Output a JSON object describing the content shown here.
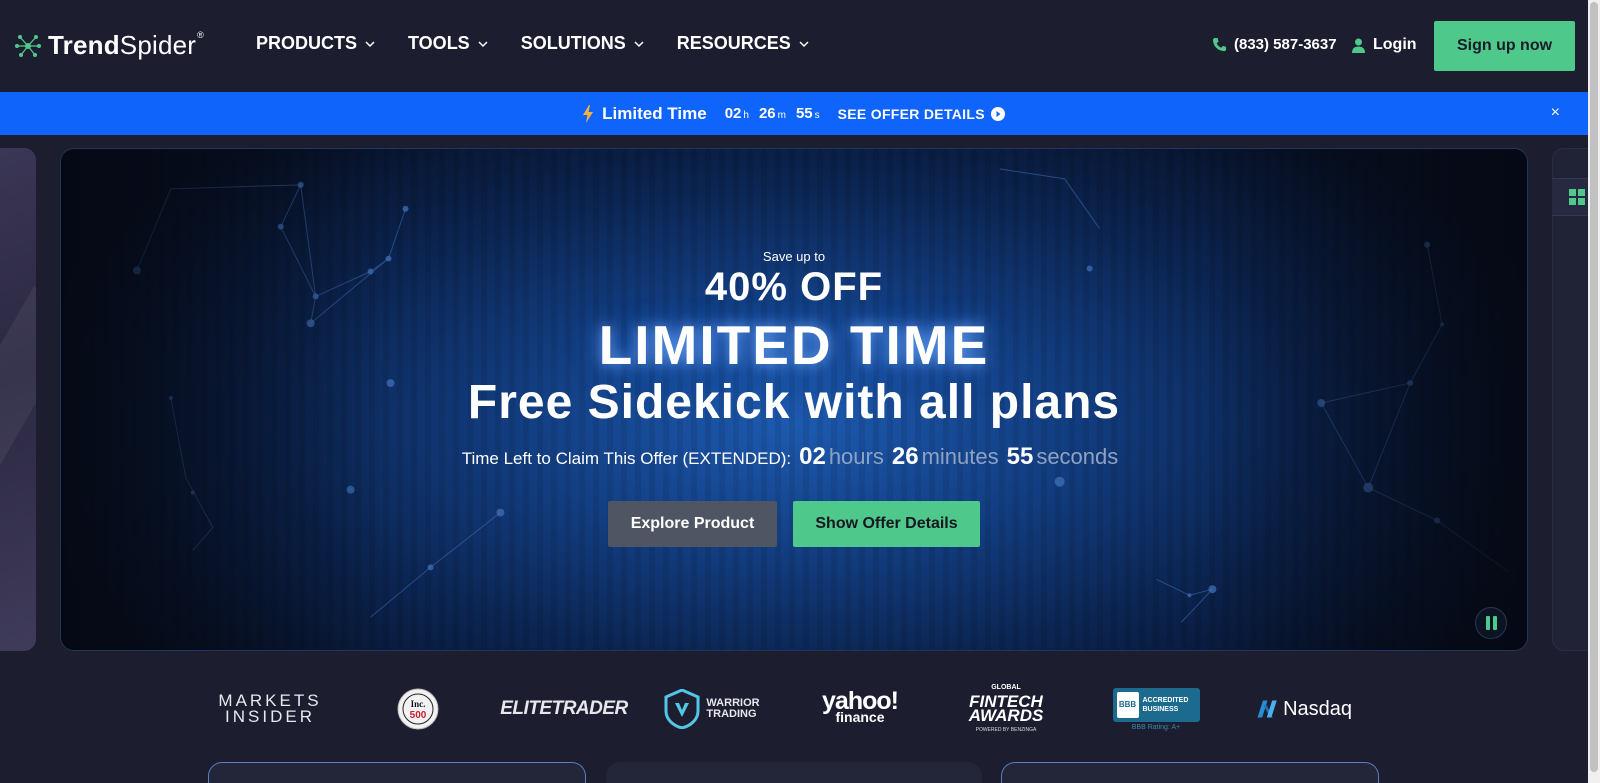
{
  "header": {
    "brand_bold": "Trend",
    "brand_thin": "Spider",
    "brand_reg": "®",
    "nav": [
      "PRODUCTS",
      "TOOLS",
      "SOLUTIONS",
      "RESOURCES"
    ],
    "phone": "(833) 587-3637",
    "login": "Login",
    "signup": "Sign up now"
  },
  "promo": {
    "label": "Limited Time",
    "hours": "02",
    "hours_unit": "h",
    "minutes": "26",
    "minutes_unit": "m",
    "seconds": "55",
    "seconds_unit": "s",
    "offer_link": "SEE OFFER DETAILS",
    "close": "×"
  },
  "hero": {
    "save_upto": "Save up to",
    "percent_off": "40% OFF",
    "headline": "LIMITED TIME",
    "subheadline": "Free Sidekick with all plans",
    "timer_label": "Time Left to Claim This Offer (EXTENDED):",
    "hours": "02",
    "hours_unit": "hours",
    "minutes": "26",
    "minutes_unit": "minutes",
    "seconds": "55",
    "seconds_unit": "seconds",
    "btn_explore": "Explore Product",
    "btn_offer": "Show Offer Details"
  },
  "logos": {
    "markets_insider_1": "MARKETS",
    "markets_insider_2": "INSIDER",
    "inc": "Inc. 500",
    "elite_trader": "ELITETRADER",
    "warrior_1": "WARRIOR",
    "warrior_2": "TRADING",
    "yahoo": "yahoo!",
    "yahoo_sub": "finance",
    "fintech_global": "GLOBAL",
    "fintech_1": "FINTECH",
    "fintech_2": "AWARDS",
    "fintech_powered": "POWERED BY BENZINGA",
    "bbb_mark": "BBB",
    "bbb_1": "ACCREDITED",
    "bbb_2": "BUSINESS",
    "bbb_rating": "BBB Rating: A+",
    "nasdaq": "Nasdaq"
  },
  "colors": {
    "accent_green": "#4fc98b",
    "promo_blue": "#0f64fb",
    "bg_navy": "#1c1d2e"
  }
}
